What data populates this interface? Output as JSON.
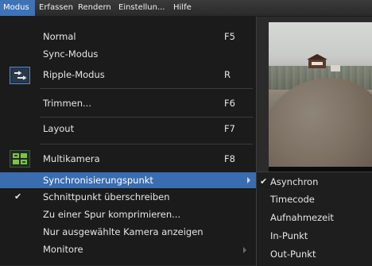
{
  "menubar": {
    "items": [
      "Modus",
      "Erfassen",
      "Rendern",
      "Einstellun...",
      "Hilfe"
    ]
  },
  "menu": {
    "items": [
      {
        "label": "Normal",
        "shortcut": "F5"
      },
      {
        "label": "Sync-Modus",
        "shortcut": ""
      },
      {
        "label": "Ripple-Modus",
        "shortcut": "R",
        "icon": "ripple-mode-icon"
      },
      {
        "label": "Trimmen...",
        "shortcut": "F6"
      },
      {
        "label": "Layout",
        "shortcut": "F7"
      },
      {
        "label": "Multikamera",
        "shortcut": "F8",
        "icon": "multicam-icon"
      },
      {
        "label": "Synchronisierungspunkt",
        "shortcut": "",
        "highlighted": true,
        "submenu": true
      },
      {
        "label": "Schnittpunkt überschreiben",
        "checked": true
      },
      {
        "label": "Zu einer Spur komprimieren..."
      },
      {
        "label": "Nur ausgewählte Kamera anzeigen"
      },
      {
        "label": "Monitore",
        "submenu": true
      }
    ],
    "check_glyph": "✔"
  },
  "submenu": {
    "items": [
      {
        "label": "Asynchron",
        "checked": true
      },
      {
        "label": "Timecode"
      },
      {
        "label": "Aufnahmezeit"
      },
      {
        "label": "In-Punkt"
      },
      {
        "label": "Out-Punkt"
      }
    ],
    "check_glyph": "✔"
  },
  "colors": {
    "highlight": "#3a6db0",
    "menubar_active": "#3e73b8",
    "menu_bg": "#1b1b1b"
  }
}
